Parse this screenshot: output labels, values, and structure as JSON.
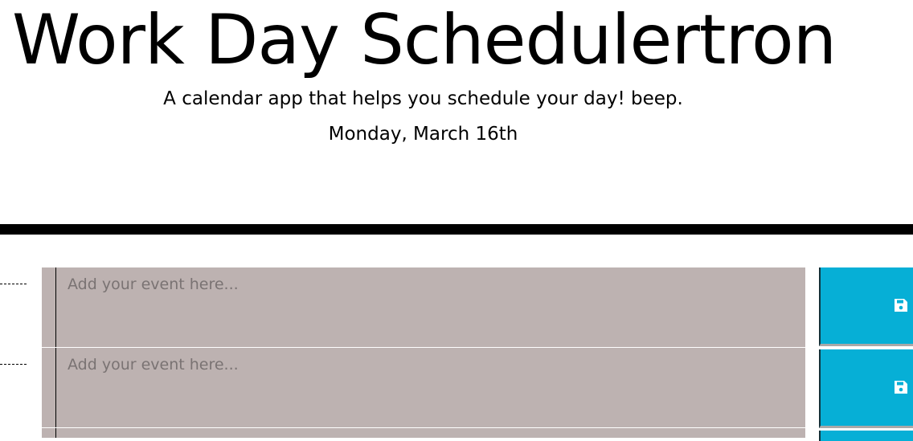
{
  "header": {
    "title": "Work Day Schedulertron",
    "tagline": "A calendar app that helps you schedule your day! beep.",
    "current_day": "Monday, March 16th"
  },
  "colors": {
    "event_background": "#bdb2b1",
    "save_button": "#06afd6",
    "divider": "#000000"
  },
  "time_blocks": [
    {
      "placeholder": "Add your event here...",
      "save_icon": "floppy-disk-icon"
    },
    {
      "placeholder": "Add your event here...",
      "save_icon": "floppy-disk-icon"
    }
  ]
}
